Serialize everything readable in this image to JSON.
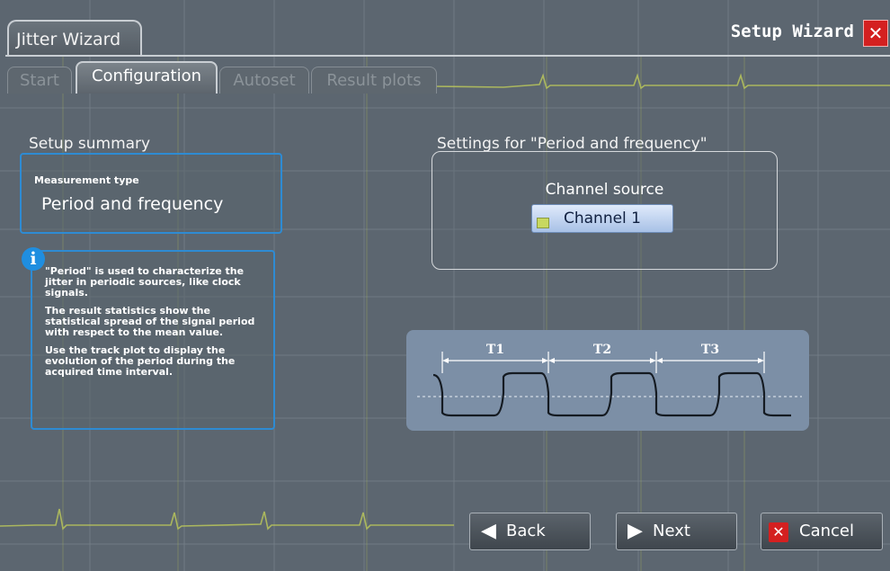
{
  "window": {
    "title_tab": "Jitter Wizard",
    "heading": "Setup Wizard"
  },
  "tabs": [
    "Start",
    "Configuration",
    "Autoset",
    "Result plots"
  ],
  "active_tab": "Configuration",
  "summary": {
    "heading": "Setup summary",
    "measurement_type_label": "Measurement type",
    "measurement_type_value": "Period and frequency",
    "info_paragraphs": [
      "\"Period\" is used to characterize the jitter in periodic sources, like clock signals.",
      "The result statistics show the statistical spread of the signal period with respect to the mean value.",
      "Use the track plot to display the evolution of the period during the acquired time interval."
    ]
  },
  "settings": {
    "heading": "Settings for \"Period and frequency\"",
    "channel_source_label": "Channel source",
    "channel_source_value": "Channel 1"
  },
  "diagram": {
    "labels": [
      "T1",
      "T2",
      "T3"
    ]
  },
  "footer": {
    "back_label": "Back",
    "next_label": "Next",
    "cancel_label": "Cancel"
  },
  "colors": {
    "accent_blue": "#2e8bd3",
    "trace_yellow": "#b8c65a",
    "cancel_red": "#d42020"
  },
  "icons": [
    "close-x-icon",
    "info-icon",
    "left-arrow-icon",
    "right-arrow-icon",
    "cancel-x-icon"
  ]
}
